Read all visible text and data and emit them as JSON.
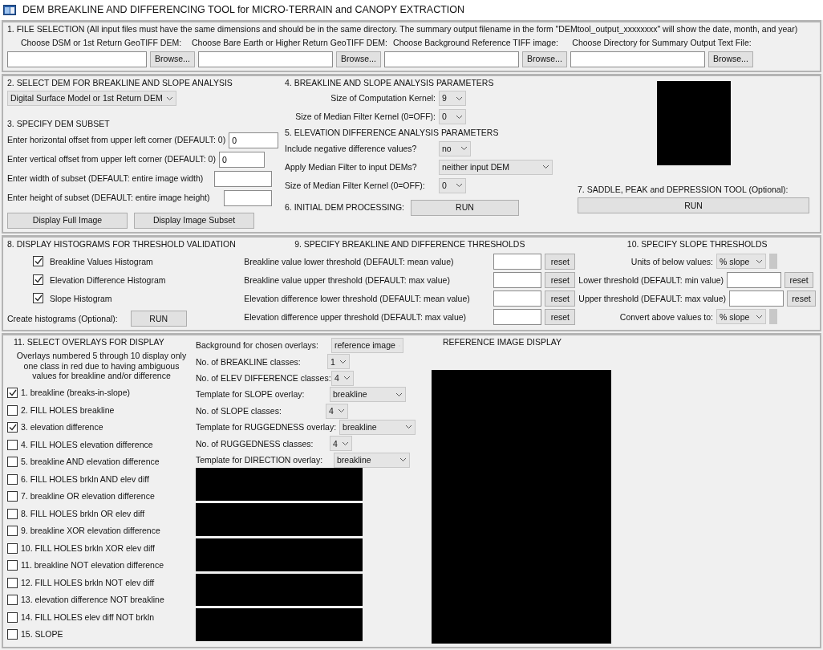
{
  "window": {
    "title": "DEM BREAKLINE AND DIFFERENCING TOOL for MICRO-TERRAIN and CANOPY EXTRACTION"
  },
  "file_selection": {
    "heading": "1. FILE SELECTION (All input files must have the same dimensions and should be in the same directory. The summary output filename in the form \"DEMtool_output_xxxxxxxx\" will show the date, month, and year)",
    "files": [
      {
        "label": "Choose DSM or 1st Return GeoTIFF DEM:",
        "button": "Browse..."
      },
      {
        "label": "Choose Bare Earth or Higher Return GeoTIFF DEM:",
        "button": "Browse..."
      },
      {
        "label": "Choose Background Reference TIFF image:",
        "button": "Browse..."
      },
      {
        "label": "Choose Directory for Summary Output Text File:",
        "button": "Browse..."
      }
    ]
  },
  "dem_selection": {
    "heading": "2. SELECT DEM FOR BREAKLINE AND SLOPE ANALYSIS",
    "value": "Digital Surface Model or 1st Return DEM"
  },
  "dem_subset": {
    "heading": "3. SPECIFY DEM SUBSET",
    "fields": [
      {
        "label": "Enter horizontal offset from upper left corner (DEFAULT: 0)",
        "value": "0"
      },
      {
        "label": "Enter vertical offset from upper left corner (DEFAULT: 0)",
        "value": "0"
      },
      {
        "label": "Enter width of subset (DEFAULT: entire image width)"
      },
      {
        "label": "Enter height of subset (DEFAULT: entire image height)"
      }
    ],
    "buttons": [
      "Display Full Image",
      "Display Image Subset"
    ]
  },
  "breakline_params": {
    "heading": "4. BREAKLINE AND SLOPE ANALYSIS PARAMETERS",
    "rows": [
      {
        "label": "Size of Computation Kernel:",
        "value": "9"
      },
      {
        "label": "Size of Median Filter Kernel (0=OFF):",
        "value": "0"
      }
    ]
  },
  "elevation_params": {
    "heading": "5. ELEVATION DIFFERENCE ANALYSIS PARAMETERS",
    "rows": [
      {
        "label": "Include negative difference values?",
        "value": "no"
      },
      {
        "label": "Apply Median Filter to input DEMs?",
        "value": "neither input DEM"
      },
      {
        "label": "Size of Median Filter Kernel (0=OFF):",
        "value": "0"
      }
    ]
  },
  "initial_processing": {
    "label": "6. INITIAL DEM PROCESSING:",
    "button": "RUN"
  },
  "saddle_tool": {
    "label": "7. SADDLE, PEAK and DEPRESSION TOOL (Optional):",
    "button": "RUN"
  },
  "histograms": {
    "heading": "8. DISPLAY HISTOGRAMS FOR THRESHOLD VALIDATION",
    "items": [
      {
        "label": "Breakline Values Histogram",
        "checked": true
      },
      {
        "label": "Elevation Difference Histogram",
        "checked": true
      },
      {
        "label": "Slope Histogram",
        "checked": true
      }
    ],
    "create_label": "Create histograms (Optional):",
    "button": "RUN"
  },
  "thresholds": {
    "heading": "9. SPECIFY BREAKLINE AND DIFFERENCE THRESHOLDS",
    "rows": [
      {
        "label": "Breakline value lower threshold (DEFAULT: mean value)",
        "button": "reset"
      },
      {
        "label": "Breakline value upper threshold (DEFAULT: max value)",
        "button": "reset"
      },
      {
        "label": "Elevation difference lower threshold (DEFAULT: mean value)",
        "button": "reset"
      },
      {
        "label": "Elevation difference upper threshold (DEFAULT: max value)",
        "button": "reset"
      }
    ]
  },
  "slope_thresholds": {
    "heading": "10. SPECIFY SLOPE THRESHOLDS",
    "rows": [
      {
        "kind": "select",
        "label": "Units of below values:",
        "value": "% slope"
      },
      {
        "kind": "input",
        "label": "Lower threshold (DEFAULT: min value)",
        "button": "reset"
      },
      {
        "kind": "input",
        "label": "Upper threshold (DEFAULT: max value)",
        "button": "reset"
      },
      {
        "kind": "select",
        "label": "Convert above values to:",
        "value": "% slope"
      }
    ]
  },
  "overlays": {
    "heading": "11. SELECT OVERLAYS FOR DISPLAY",
    "note": "Overlays numbered 5 through 10 display only\none class in red due to having ambiguous\nvalues for breakline and/or difference",
    "items": [
      {
        "label": "1.  breakline (breaks-in-slope)",
        "checked": true
      },
      {
        "label": "2.  FILL HOLES breakline",
        "checked": false
      },
      {
        "label": "3.  elevation difference",
        "checked": true
      },
      {
        "label": "4.  FILL HOLES elevation difference",
        "checked": false
      },
      {
        "label": "5.  breakline AND elevation difference",
        "checked": false
      },
      {
        "label": "6.  FILL HOLES brkln AND elev diff",
        "checked": false
      },
      {
        "label": "7.  breakline OR elevation difference",
        "checked": false
      },
      {
        "label": "8.  FILL HOLES brkln OR elev diff",
        "checked": false
      },
      {
        "label": "9.  breakline XOR elevation difference",
        "checked": false
      },
      {
        "label": "10. FILL HOLES brkln XOR elev diff",
        "checked": false
      },
      {
        "label": "11. breakline NOT elevation difference",
        "checked": false
      },
      {
        "label": "12. FILL HOLES brkln NOT elev diff",
        "checked": false
      },
      {
        "label": "13. elevation difference NOT breakline",
        "checked": false
      },
      {
        "label": "14. FILL HOLES elev diff NOT brkln",
        "checked": false
      },
      {
        "label": "15. SLOPE",
        "checked": false
      }
    ],
    "settings": [
      {
        "label": "Background for chosen overlays:",
        "value": "reference image"
      },
      {
        "label": "No. of BREAKLINE classes:",
        "value": "1"
      },
      {
        "label": "No. of ELEV DIFFERENCE classes:",
        "value": "4"
      },
      {
        "label": "Template for SLOPE overlay:",
        "value": "breakline"
      },
      {
        "label": "No. of SLOPE classes:",
        "value": "4"
      },
      {
        "label": "Template for RUGGEDNESS overlay:",
        "value": "breakline"
      },
      {
        "label": "No. of RUGGEDNESS classes:",
        "value": "4"
      },
      {
        "label": "Template for DIRECTION overlay:",
        "value": "breakline"
      }
    ]
  },
  "reference_display": {
    "heading": "REFERENCE IMAGE DISPLAY"
  }
}
